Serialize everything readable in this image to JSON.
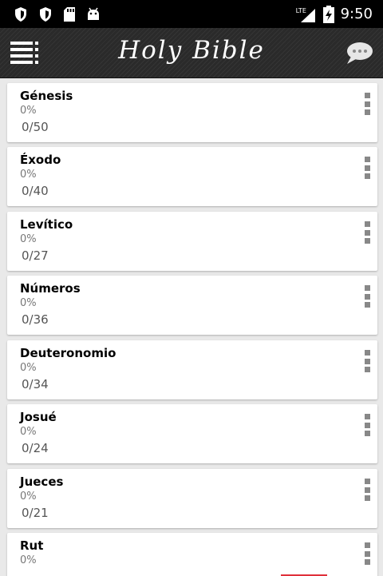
{
  "status_bar": {
    "time": "9:50",
    "network": "LTE",
    "icons": [
      "shield-icon",
      "shield-icon",
      "sd-card-icon",
      "android-icon"
    ]
  },
  "app_bar": {
    "title": "Holy Bible",
    "menu_icon": "menu-icon",
    "chat_icon": "chat-bubble-icon"
  },
  "books": [
    {
      "name": "Génesis",
      "progress": "0%",
      "chapters": "0/50"
    },
    {
      "name": "Éxodo",
      "progress": "0%",
      "chapters": "0/40"
    },
    {
      "name": "Levítico",
      "progress": "0%",
      "chapters": "0/27"
    },
    {
      "name": "Números",
      "progress": "0%",
      "chapters": "0/36"
    },
    {
      "name": "Deuteronomio",
      "progress": "0%",
      "chapters": "0/34"
    },
    {
      "name": "Josué",
      "progress": "0%",
      "chapters": "0/24"
    },
    {
      "name": "Jueces",
      "progress": "0%",
      "chapters": "0/21"
    },
    {
      "name": "Rut",
      "progress": "0%",
      "chapters": ""
    }
  ]
}
